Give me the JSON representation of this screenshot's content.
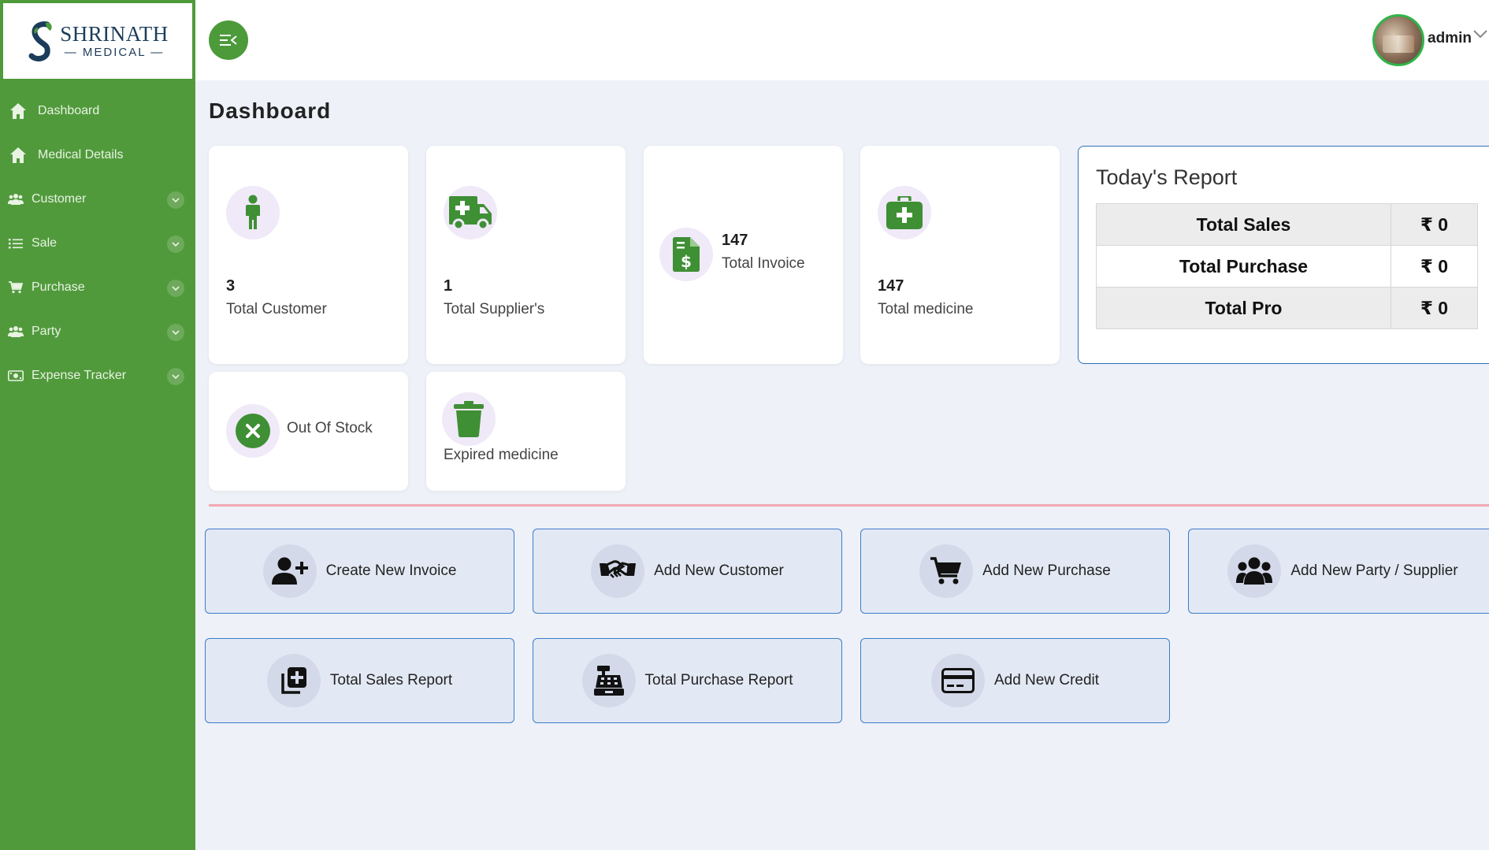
{
  "brand": {
    "name": "SHRINATH",
    "sub": "— MEDICAL —"
  },
  "sidebar": {
    "items": [
      {
        "label": "Dashboard",
        "icon": "home-icon",
        "chevron": false
      },
      {
        "label": "Medical Details",
        "icon": "home-icon",
        "chevron": false
      },
      {
        "label": "Customer",
        "icon": "users-icon",
        "chevron": true
      },
      {
        "label": "Sale",
        "icon": "list-icon",
        "chevron": true
      },
      {
        "label": "Purchase",
        "icon": "cart-icon",
        "chevron": true
      },
      {
        "label": "Party",
        "icon": "users-icon",
        "chevron": true
      },
      {
        "label": "Expense Tracker",
        "icon": "money-icon",
        "chevron": true
      }
    ]
  },
  "header": {
    "user": "admin"
  },
  "page": {
    "title": "Dashboard"
  },
  "stats": {
    "customer": {
      "value": "3",
      "label": "Total Customer"
    },
    "supplier": {
      "value": "1",
      "label": "Total Supplier's"
    },
    "invoice": {
      "value": "147",
      "label": "Total Invoice"
    },
    "medicine": {
      "value": "147",
      "label": "Total medicine"
    },
    "out_of_stock": {
      "label": "Out Of Stock"
    },
    "expired": {
      "label": "Expired medicine"
    }
  },
  "report": {
    "title": "Today's Report",
    "rows": [
      {
        "label": "Total Sales",
        "value": "₹ 0",
        "color": "#1e8a3c"
      },
      {
        "label": "Total Purchase",
        "value": "₹ 0",
        "color": "#d9262e"
      },
      {
        "label": "Total Pro",
        "value": "₹ 0",
        "color": "#d9262e"
      }
    ]
  },
  "actions": [
    {
      "label": "Create New Invoice",
      "icon": "user-plus-icon"
    },
    {
      "label": "Add New Customer",
      "icon": "handshake-icon"
    },
    {
      "label": "Add New Purchase",
      "icon": "cart-icon"
    },
    {
      "label": "Add New Party / Supplier",
      "icon": "users-icon"
    },
    {
      "label": "Total Sales Report",
      "icon": "copy-plus-icon"
    },
    {
      "label": "Total Purchase Report",
      "icon": "cash-register-icon"
    },
    {
      "label": "Add New Credit",
      "icon": "credit-card-icon"
    }
  ],
  "colors": {
    "sidebar": "#519a3c",
    "accent": "#4c9a3a",
    "border_blue": "#3d7cc9",
    "divider": "#f1a9b4"
  }
}
